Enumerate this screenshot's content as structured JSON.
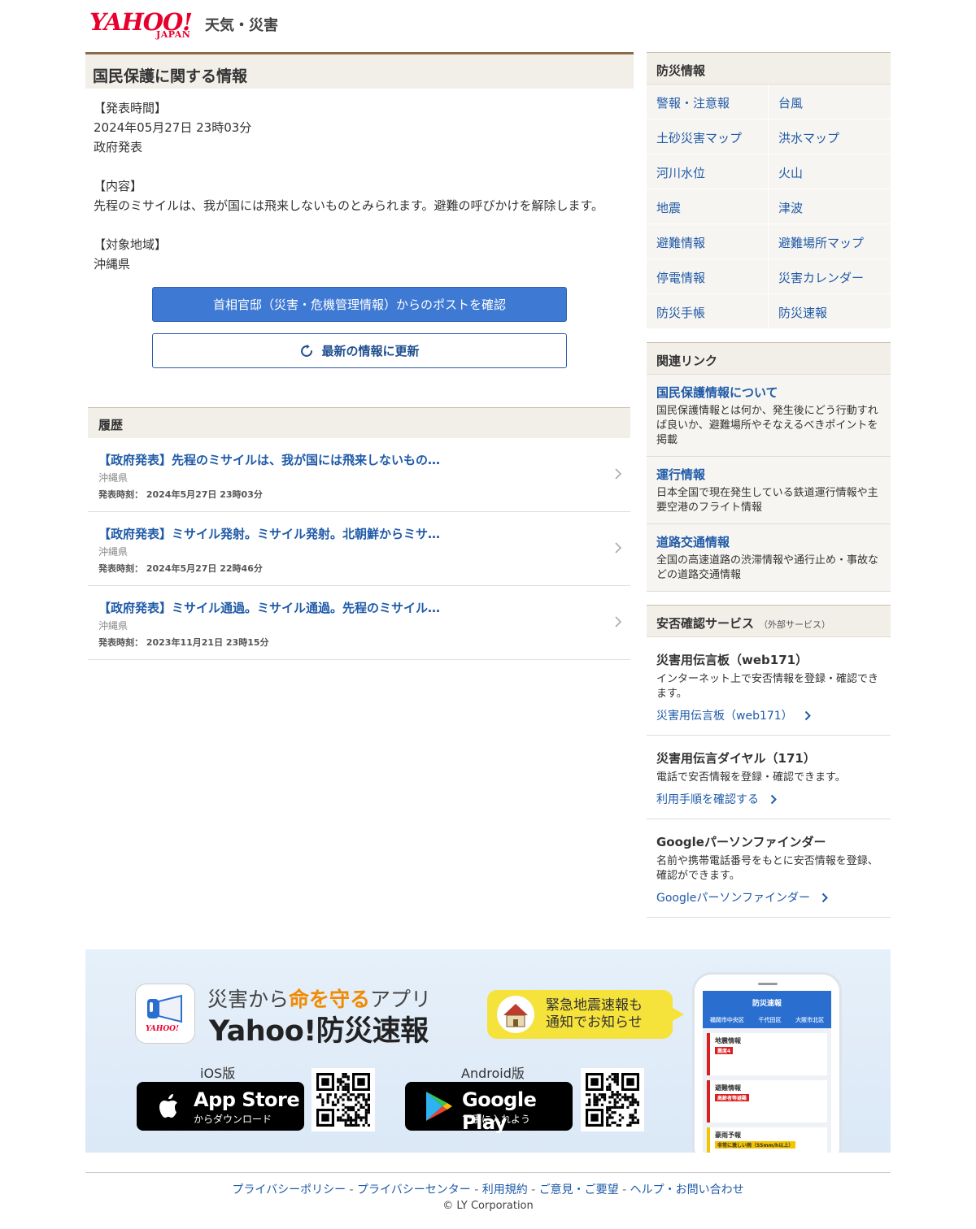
{
  "header": {
    "logo_text": "YAHOO!",
    "logo_sub": "JAPAN",
    "service": "天気・災害"
  },
  "main": {
    "title": "国民保護に関する情報",
    "time_label": "【発表時間】",
    "time_value": "2024年05月27日 23時03分",
    "publisher": "政府発表",
    "content_label": "【内容】",
    "content_value": "先程のミサイルは、我が国には飛来しないものとみられます。避難の呼びかけを解除します。",
    "area_label": "【対象地域】",
    "area_value": "沖縄県",
    "btn_post": "首相官邸（災害・危機管理情報）からのポストを確認",
    "btn_refresh": "最新の情報に更新"
  },
  "history": {
    "title": "履歴",
    "items": [
      {
        "title": "【政府発表】先程のミサイルは、我が国には飛来しないもの…",
        "area": "沖縄県",
        "time_label": "発表時刻：",
        "time": "2024年5月27日 23時03分"
      },
      {
        "title": "【政府発表】ミサイル発射。ミサイル発射。北朝鮮からミサ…",
        "area": "沖縄県",
        "time_label": "発表時刻：",
        "time": "2024年5月27日 22時46分"
      },
      {
        "title": "【政府発表】ミサイル通過。ミサイル通過。先程のミサイル…",
        "area": "沖縄県",
        "time_label": "発表時刻：",
        "time": "2023年11月21日 23時15分"
      }
    ]
  },
  "disaster": {
    "title": "防災情報",
    "links": [
      "警報・注意報",
      "台風",
      "土砂災害マップ",
      "洪水マップ",
      "河川水位",
      "火山",
      "地震",
      "津波",
      "避難情報",
      "避難場所マップ",
      "停電情報",
      "災害カレンダー",
      "防災手帳",
      "防災速報"
    ]
  },
  "related": {
    "title": "関連リンク",
    "items": [
      {
        "title": "国民保護情報について",
        "desc": "国民保護情報とは何か、発生後にどう行動すれば良いか、避難場所やそなえるべきポイントを掲載"
      },
      {
        "title": "運行情報",
        "desc": "日本全国で現在発生している鉄道運行情報や主要空港のフライト情報"
      },
      {
        "title": "道路交通情報",
        "desc": "全国の高速道路の渋滞情報や通行止め・事故などの道路交通情報"
      }
    ]
  },
  "safety": {
    "title": "安否確認サービス",
    "ext": "（外部サービス）",
    "items": [
      {
        "title": "災害用伝言板（web171）",
        "desc": "インターネット上で安否情報を登録・確認できます。",
        "link": "災害用伝言板（web171）"
      },
      {
        "title": "災害用伝言ダイヤル（171）",
        "desc": "電話で安否情報を登録・確認できます。",
        "link": "利用手順を確認する"
      },
      {
        "title": "Googleパーソンファインダー",
        "desc": "名前や携帯電話番号をもとに安否情報を登録、確認ができます。",
        "link": "Googleパーソンファインダー"
      }
    ]
  },
  "banner": {
    "tag_pre": "災害から",
    "tag_hl": "命を守る",
    "tag_post": "アプリ",
    "app_name": "Yahoo!防災速報",
    "icon_text": "YAHOO!",
    "bubble_line1": "緊急地震速報も",
    "bubble_line2": "通知でお知らせ",
    "ios_label": "iOS版",
    "android_label": "Android版",
    "appstore_main": "App Store",
    "appstore_sub": "からダウンロード",
    "gplay_main": "Google Play",
    "gplay_sub": "で手に入れよう",
    "phone_head": "防災速報",
    "phone_tabs": [
      "福岡市中央区",
      "千代田区",
      "大阪市北区"
    ],
    "phone_cards": [
      {
        "title": "地震情報",
        "tag": "震度4"
      },
      {
        "title": "避難情報",
        "tag": "高齢者等避難"
      },
      {
        "title": "豪雨予報",
        "tag": "非常に激しい雨（55mm/h以上）"
      }
    ]
  },
  "footer": {
    "links": [
      "プライバシーポリシー",
      "プライバシーセンター",
      "利用規約",
      "ご意見・ご要望",
      "ヘルプ・お問い合わせ"
    ],
    "sep": " - ",
    "copyright": "© LY Corporation"
  },
  "colors": {
    "accent": "#3e79d4",
    "link": "#1f5aa8",
    "brand": "#e8002d",
    "title_bar": "#f2efe9"
  }
}
